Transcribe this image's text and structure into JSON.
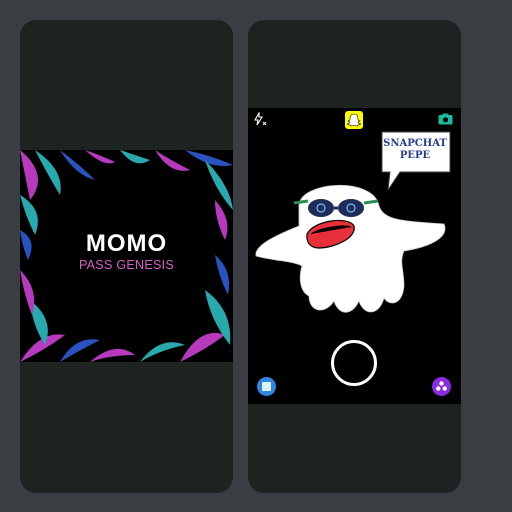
{
  "left_card": {
    "title": "MOMO",
    "subtitle": "PASS GENESIS",
    "colors": {
      "background": "#000000",
      "title": "#ffffff",
      "subtitle": "#d65fc6",
      "leaf_pink": "#c13dc8",
      "leaf_teal": "#2bb3b8",
      "leaf_blue": "#2c58c9"
    }
  },
  "camera_screen": {
    "icons": {
      "flash": "flash-off-icon",
      "ghost": "snapchat-ghost-icon",
      "camera": "camera-flip-icon",
      "memories": "memories-icon",
      "lenses": "lenses-icon"
    },
    "speech_bubble": {
      "line1": "SNAPCHAT",
      "line2": "PEPE"
    },
    "colors": {
      "snap_yellow": "#fffc00",
      "camera_icon": "#1abc9c",
      "memories": "#2e86de",
      "lenses": "#8a2be2"
    }
  }
}
